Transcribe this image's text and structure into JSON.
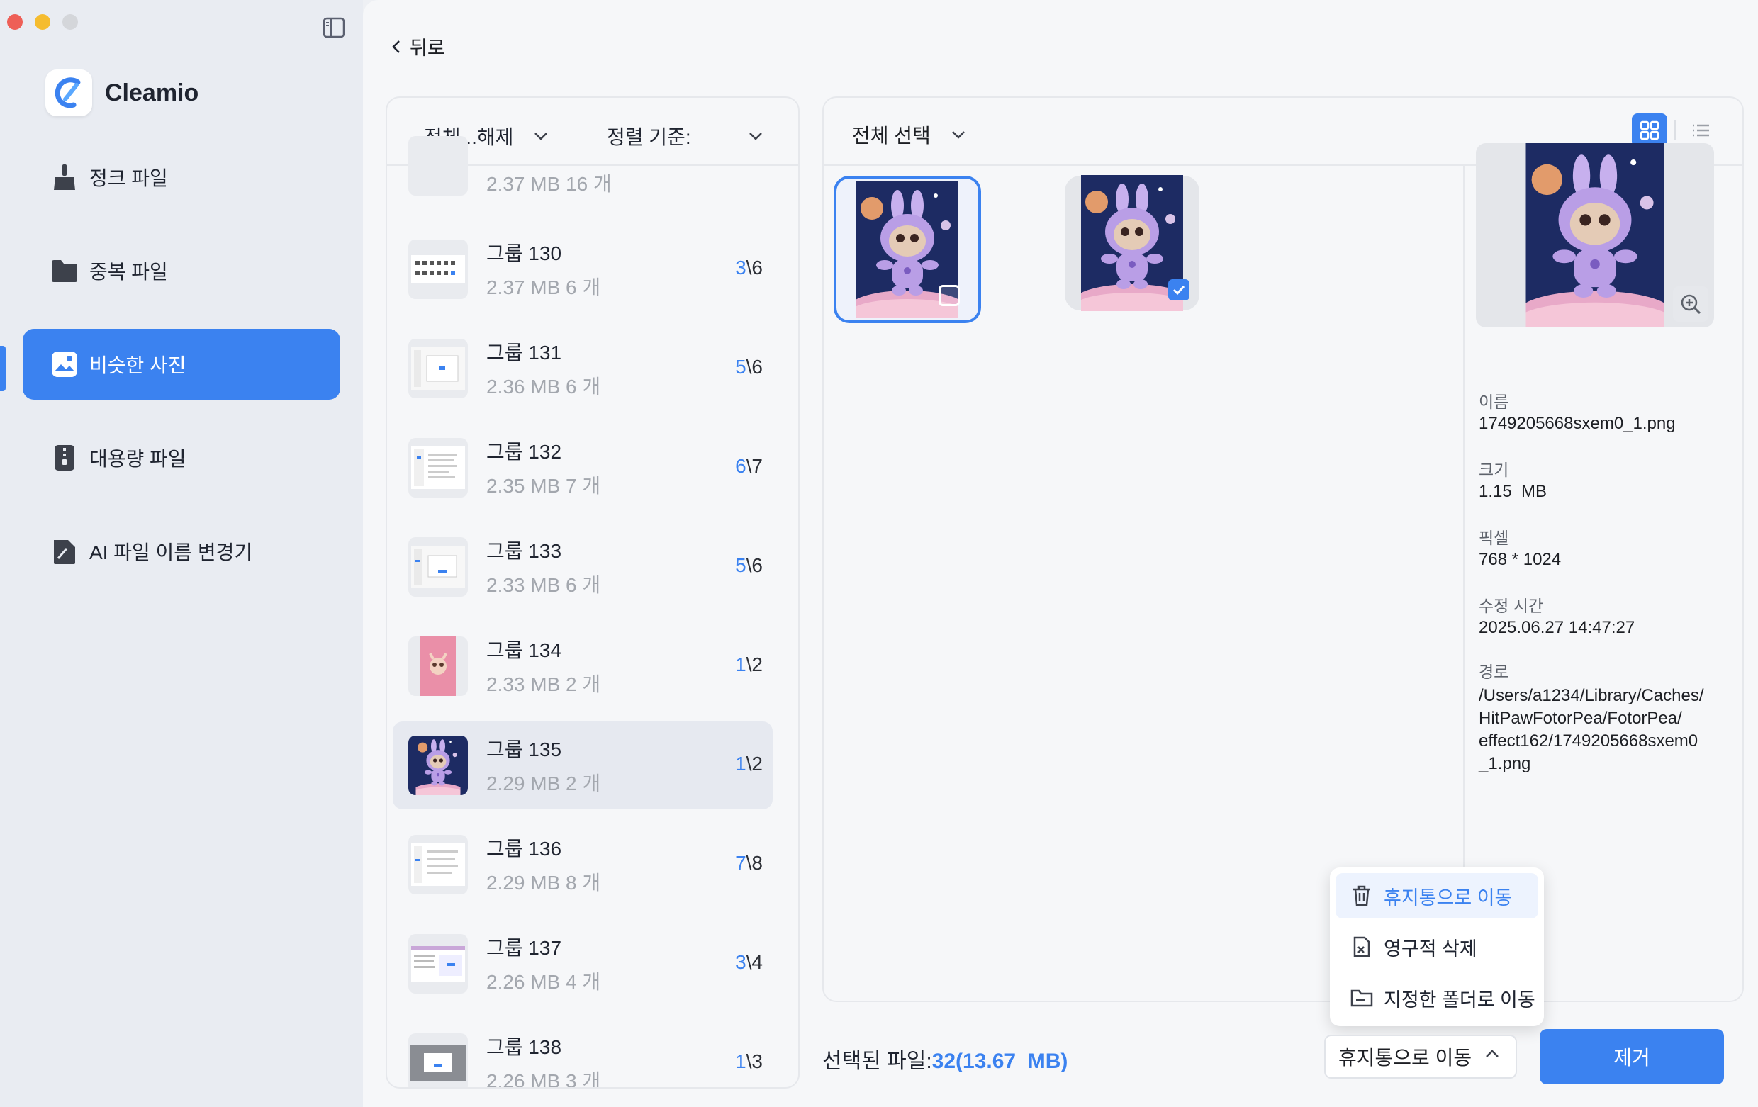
{
  "window": {
    "controls": [
      "close",
      "minimize",
      "zoom"
    ]
  },
  "app": {
    "name": "Cleamio"
  },
  "sidebar": {
    "items": [
      {
        "label": "정크 파일",
        "icon": "broom-icon"
      },
      {
        "label": "중복 파일",
        "icon": "folder-icon"
      },
      {
        "label": "비슷한 사진",
        "icon": "photo-icon",
        "active": true
      },
      {
        "label": "대용량 파일",
        "icon": "zip-file-icon"
      },
      {
        "label": "AI 파일 이름 변경기",
        "icon": "rename-file-icon"
      }
    ]
  },
  "header": {
    "back_label": "뒤로"
  },
  "groups_panel": {
    "filter_label": "전체...해제",
    "sort_label": "정렬 기준:",
    "partial_row": {
      "meta": "2.37  MB  16 개"
    },
    "rows": [
      {
        "title": "그룹 130",
        "meta": "2.37  MB  6 개",
        "selected_count": "3",
        "total": "\\6"
      },
      {
        "title": "그룹 131",
        "meta": "2.36  MB  6 개",
        "selected_count": "5",
        "total": "\\6"
      },
      {
        "title": "그룹 132",
        "meta": "2.35  MB  7 개",
        "selected_count": "6",
        "total": "\\7"
      },
      {
        "title": "그룹 133",
        "meta": "2.33  MB  6 개",
        "selected_count": "5",
        "total": "\\6"
      },
      {
        "title": "그룹 134",
        "meta": "2.33  MB  2 개",
        "selected_count": "1",
        "total": "\\2"
      },
      {
        "title": "그룹 135",
        "meta": "2.29  MB  2 개",
        "selected_count": "1",
        "total": "\\2",
        "selected": true
      },
      {
        "title": "그룹 136",
        "meta": "2.29  MB  8 개",
        "selected_count": "7",
        "total": "\\8"
      },
      {
        "title": "그룹 137",
        "meta": "2.26  MB  4 개",
        "selected_count": "3",
        "total": "\\4"
      },
      {
        "title": "그룹 138",
        "meta": "2.26  MB  3 개",
        "selected_count": "1",
        "total": "\\3"
      }
    ]
  },
  "detail_panel": {
    "select_all_label": "전체 선택",
    "view_modes": [
      "grid-view-icon",
      "list-view-icon"
    ],
    "photos": [
      {
        "focused": true,
        "checked": false
      },
      {
        "focused": false,
        "checked": true
      }
    ],
    "info": {
      "name_label": "이름",
      "name_value": "1749205668sxem0_1.png",
      "size_label": "크기",
      "size_value": "1.15  MB",
      "pixel_label": "픽셀",
      "pixel_value": "768 * 1024",
      "modified_label": "수정 시간",
      "modified_value": "2025.06.27 14:47:27",
      "path_label": "경로",
      "path_lines": [
        "/Users/a1234/Library/Caches/",
        "HitPawFotorPea/FotorPea/",
        "effect162/1749205668sxem0",
        "_1.png"
      ]
    }
  },
  "footer": {
    "selected_prefix": "선택된 파일:",
    "selected_value": "32(13.67  MB)",
    "action_current": "휴지통으로 이동",
    "remove_label": "제거"
  },
  "action_menu": {
    "items": [
      {
        "label": "휴지통으로 이동",
        "icon": "trash-icon",
        "active": true
      },
      {
        "label": "영구적 삭제",
        "icon": "delete-file-icon"
      },
      {
        "label": "지정한 폴더로 이동",
        "icon": "folder-move-icon"
      }
    ]
  },
  "colors": {
    "accent": "#3b82f0",
    "sidebar_bg": "#e9ecf2",
    "main_bg": "#f6f7f9"
  }
}
